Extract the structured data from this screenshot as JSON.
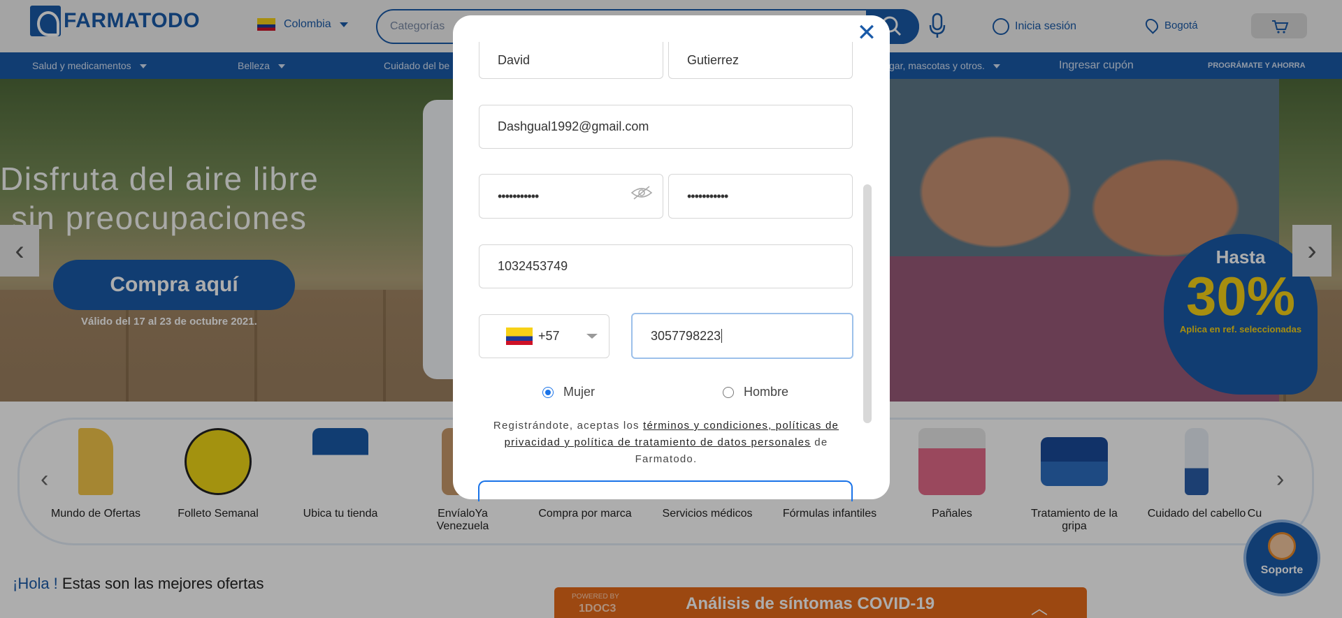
{
  "header": {
    "logo_text": "FARMATODO",
    "country": "Colombia",
    "search_category": "Categorías",
    "login": "Inicia sesión",
    "city": "Bogotá"
  },
  "nav": {
    "items": [
      "Salud y medicamentos",
      "Belleza",
      "Cuidado del be",
      "gar, mascotas y otros.",
      "Ingresar cupón",
      "PROGRÁMATE Y AHORRA"
    ]
  },
  "banner": {
    "title_line1": "Disfruta del aire libre",
    "title_line2": "sin preocupaciones",
    "cta": "Compra aquí",
    "valid": "Válido del 17 al 23 de octubre 2021.",
    "badge_top": "Hasta",
    "badge_pct": "30%",
    "badge_note": "Aplica en ref. seleccionadas"
  },
  "categories": [
    "Mundo de Ofertas",
    "Folleto Semanal",
    "Ubica tu tienda",
    "EnvíaloYa Venezuela",
    "Compra por marca",
    "Servicios médicos",
    "Fórmulas infantiles",
    "Pañales",
    "Tratamiento de la gripa",
    "Cuidado del cabello",
    "Cu"
  ],
  "greeting": {
    "hola": "¡Hola !",
    "rest": " Estas son las mejores ofertas"
  },
  "covid": {
    "powered": "POWERED BY",
    "brand": "1DOC3",
    "title": "Análisis de síntomas COVID-19"
  },
  "support": "Soporte",
  "form": {
    "first_name": "David",
    "last_name": "Gutierrez",
    "email": "Dashgual1992@gmail.com",
    "password_mask": "•••••••••••",
    "confirm_mask": "•••••••••••",
    "document": "1032453749",
    "dial_code": "+57",
    "phone": "3057798223",
    "gender_female": "Mujer",
    "gender_male": "Hombre",
    "terms_prefix": "Registrándote, aceptas los ",
    "terms_link": "términos y condiciones, políticas de privacidad y política de tratamiento de datos personales",
    "terms_suffix": " de Farmatodo."
  },
  "colors": {
    "brand_blue": "#1a5aa8",
    "covid_orange": "#e66a1a",
    "focus_border": "#9cc0ea"
  },
  "icons": [
    "search-icon",
    "microphone-icon",
    "user-icon",
    "location-pin-icon",
    "cart-icon",
    "close-icon",
    "eye-slash-icon",
    "chevron-left-icon",
    "chevron-right-icon",
    "chevron-up-icon"
  ]
}
